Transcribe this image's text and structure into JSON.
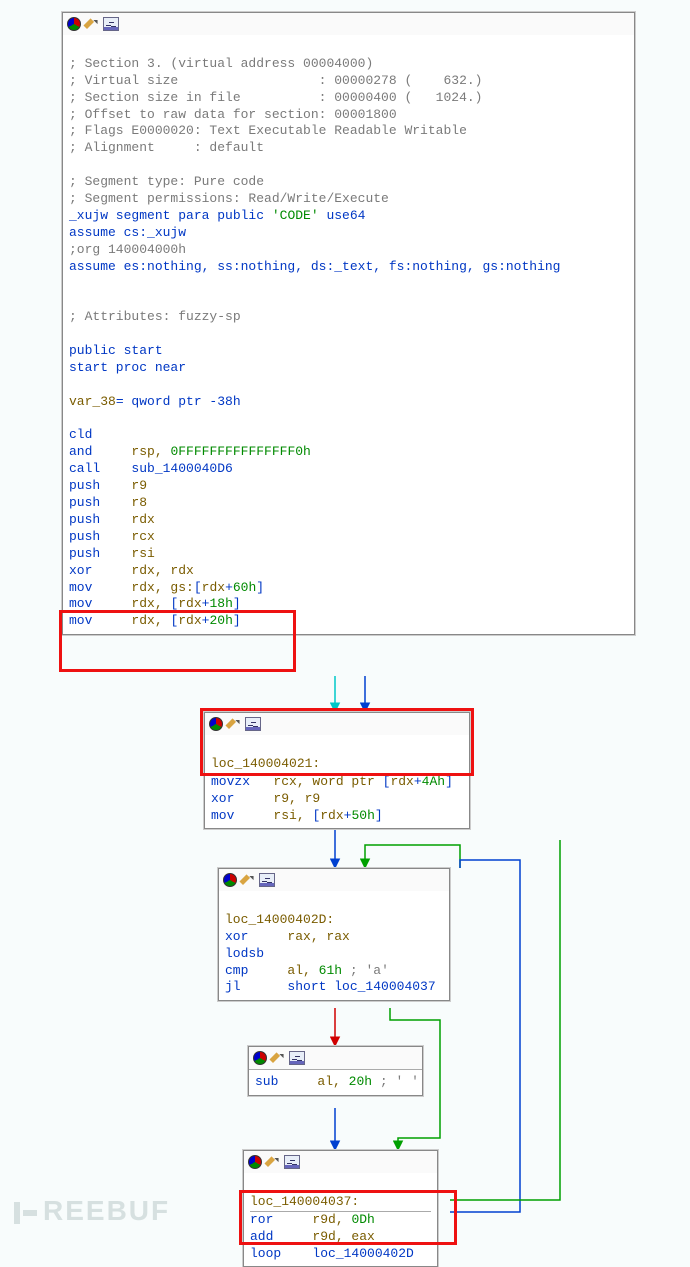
{
  "watermark": "REEBUF",
  "node1": {
    "comments": [
      "; Section 3. (virtual address 00004000)",
      "; Virtual size                  : 00000278 (    632.)",
      "; Section size in file          : 00000400 (   1024.)",
      "; Offset to raw data for section: 00001800",
      "; Flags E0000020: Text Executable Readable Writable",
      "; Alignment     : default"
    ],
    "seg_gray": [
      "; Segment type: Pure code",
      "; Segment permissions: Read/Write/Execute"
    ],
    "seg_decl_pre": "_xujw segment para public ",
    "seg_decl_str": "'CODE'",
    "seg_decl_post": " use64",
    "assume_cs": "assume cs:_xujw",
    "org_comment": ";org 140004000h",
    "assume_seg": "assume es:nothing, ss:nothing, ds:_text, fs:nothing, gs:nothing",
    "attr_comment": "; Attributes: fuzzy-sp",
    "public_start": "public start",
    "start_proc": "start proc near",
    "var_decl_1": "var_38",
    "var_decl_2": "= qword ptr -38h",
    "ins": [
      {
        "op": "cld",
        "args": []
      },
      {
        "op": "and",
        "args": [
          {
            "t": "rsp, ",
            "c": "brown"
          },
          {
            "t": "0FFFFFFFFFFFFFFF0h",
            "c": "green"
          }
        ]
      },
      {
        "op": "call",
        "args": [
          {
            "t": "sub_1400040D6",
            "c": "blue"
          }
        ]
      },
      {
        "op": "push",
        "args": [
          {
            "t": "r9",
            "c": "brown"
          }
        ]
      },
      {
        "op": "push",
        "args": [
          {
            "t": "r8",
            "c": "brown"
          }
        ]
      },
      {
        "op": "push",
        "args": [
          {
            "t": "rdx",
            "c": "brown"
          }
        ]
      },
      {
        "op": "push",
        "args": [
          {
            "t": "rcx",
            "c": "brown"
          }
        ]
      },
      {
        "op": "push",
        "args": [
          {
            "t": "rsi",
            "c": "brown"
          }
        ]
      },
      {
        "op": "xor",
        "args": [
          {
            "t": "rdx, rdx",
            "c": "brown"
          }
        ]
      },
      {
        "op": "mov",
        "args": [
          {
            "t": "rdx, gs:",
            "c": "brown"
          },
          {
            "t": "[",
            "c": "blue"
          },
          {
            "t": "rdx",
            "c": "brown"
          },
          {
            "t": "+",
            "c": "blue"
          },
          {
            "t": "60h",
            "c": "green"
          },
          {
            "t": "]",
            "c": "blue"
          }
        ]
      },
      {
        "op": "mov",
        "args": [
          {
            "t": "rdx, ",
            "c": "brown"
          },
          {
            "t": "[",
            "c": "blue"
          },
          {
            "t": "rdx",
            "c": "brown"
          },
          {
            "t": "+",
            "c": "blue"
          },
          {
            "t": "18h",
            "c": "green"
          },
          {
            "t": "]",
            "c": "blue"
          }
        ]
      },
      {
        "op": "mov",
        "args": [
          {
            "t": "rdx, ",
            "c": "brown"
          },
          {
            "t": "[",
            "c": "blue"
          },
          {
            "t": "rdx",
            "c": "brown"
          },
          {
            "t": "+",
            "c": "blue"
          },
          {
            "t": "20h",
            "c": "green"
          },
          {
            "t": "]",
            "c": "blue"
          }
        ]
      }
    ]
  },
  "node2": {
    "label": "loc_140004021:",
    "ins": [
      {
        "op": "movzx",
        "args": [
          {
            "t": "rcx, word ptr ",
            "c": "brown"
          },
          {
            "t": "[",
            "c": "blue"
          },
          {
            "t": "rdx",
            "c": "brown"
          },
          {
            "t": "+",
            "c": "blue"
          },
          {
            "t": "4Ah",
            "c": "green"
          },
          {
            "t": "]",
            "c": "blue"
          }
        ]
      },
      {
        "op": "xor",
        "args": [
          {
            "t": "r9, r9",
            "c": "brown"
          }
        ]
      },
      {
        "op": "mov",
        "args": [
          {
            "t": "rsi, ",
            "c": "brown"
          },
          {
            "t": "[",
            "c": "blue"
          },
          {
            "t": "rdx",
            "c": "brown"
          },
          {
            "t": "+",
            "c": "blue"
          },
          {
            "t": "50h",
            "c": "green"
          },
          {
            "t": "]",
            "c": "blue"
          }
        ]
      }
    ]
  },
  "node3": {
    "label": "loc_14000402D:",
    "ins": [
      {
        "op": "xor",
        "args": [
          {
            "t": "rax, rax",
            "c": "brown"
          }
        ]
      },
      {
        "op": "lodsb",
        "args": []
      },
      {
        "op": "cmp",
        "args": [
          {
            "t": "al, ",
            "c": "brown"
          },
          {
            "t": "61h ",
            "c": "green"
          },
          {
            "t": "; 'a'",
            "c": "gray"
          }
        ]
      },
      {
        "op": "jl",
        "args": [
          {
            "t": "short loc_140004037",
            "c": "blue"
          }
        ]
      }
    ]
  },
  "node4": {
    "ins": [
      {
        "op": "sub",
        "args": [
          {
            "t": "al, ",
            "c": "brown"
          },
          {
            "t": "20h ",
            "c": "green"
          },
          {
            "t": "; ' '",
            "c": "gray"
          }
        ]
      }
    ]
  },
  "node5": {
    "label": "loc_140004037:",
    "ins": [
      {
        "op": "ror",
        "args": [
          {
            "t": "r9d, ",
            "c": "brown"
          },
          {
            "t": "0Dh",
            "c": "green"
          }
        ]
      },
      {
        "op": "add",
        "args": [
          {
            "t": "r9d, eax",
            "c": "brown"
          }
        ]
      },
      {
        "op": "loop",
        "args": [
          {
            "t": "loc_14000402D",
            "c": "blue"
          }
        ]
      }
    ]
  }
}
